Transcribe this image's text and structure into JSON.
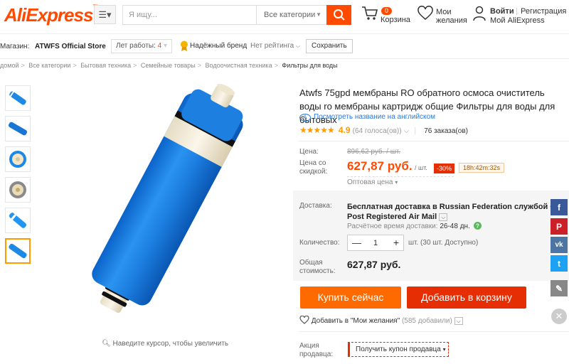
{
  "header": {
    "logo": "AliExpress",
    "logo_tm": "™",
    "menu_icon": "☰▾",
    "search_placeholder": "Я ищу...",
    "search_category": "Все категории",
    "cart_count": "0",
    "cart_label": "Корзина",
    "wishlist_line1": "Мои",
    "wishlist_line2": "желания",
    "login": "Войти",
    "separator": "|",
    "register": "Регистрация",
    "my_aliexpress": "Мой AliExpress",
    "brand_color": "#ff4a00"
  },
  "store": {
    "label": "Магазин:",
    "name": "ATWFS Official Store",
    "years_label": "Лет работы:",
    "years_value": "4",
    "brand_badge": "Надёжный бренд",
    "rating": "Нет рейтинга",
    "save_button": "Сохранить"
  },
  "breadcrumb": [
    "домой",
    "Все категории",
    "Бытовая техника",
    "Семейные товары",
    "Водоочистная техника",
    "Фильтры для воды"
  ],
  "gallery": {
    "zoom_hint": "Наведите курсор, чтобы увеличить",
    "thumbnail_count": 6,
    "active_thumbnail": 6
  },
  "product": {
    "title": "Atwfs 75gpd мембраны RO обратного осмоса очиститель воды ro мембраны картридж общие Фильтры для воды для бытовых",
    "translate_badge": "À",
    "translate_link": "Посмотреть название на английском",
    "stars": "★★★★★",
    "rating": "4.9",
    "votes": "(64 голоса(ов))",
    "orders": "76 заказа(ов)",
    "price_label": "Цена:",
    "old_price": "896,62 руб. / шт.",
    "discount_price_label": "Цена со скидкой:",
    "new_price": "627,87 руб.",
    "unit": "/ шт.",
    "discount": "-30%",
    "timer": "18h:42m:32s",
    "wholesale": "Оптовая цена",
    "shipping_label": "Доставка:",
    "shipping_line1": "Бесплатная доставка в Russian Federation службой China",
    "shipping_line2": "Post Registered Air Mail",
    "eta_label": "Расчётное время доставки:",
    "eta_value": "26-48",
    "eta_unit": "дн.",
    "quantity_label": "Количество:",
    "quantity_minus": "—",
    "quantity_value": "1",
    "quantity_plus": "+",
    "quantity_available": "шт. (30 шт. Доступно)",
    "total_label_1": "Общая",
    "total_label_2": "стоимость:",
    "total_value": "627,87 руб.",
    "buy_now": "Купить сейчас",
    "add_to_cart": "Добавить в корзину",
    "wish_text": "Добавить в \"Мои желания\"",
    "wish_count": "(585 добавили)",
    "promo_label_1": "Акция",
    "promo_label_2": "продавца:",
    "coupon": "Получить купон продавца"
  },
  "social": {
    "facebook": "f",
    "pinterest": "P",
    "vk": "vk",
    "twitter": "t",
    "edit": "✎",
    "close": "✕",
    "colors": {
      "facebook": "#3b5998",
      "pinterest": "#cb2027",
      "vk": "#4c75a3",
      "twitter": "#1da1f2",
      "edit": "#888888"
    }
  }
}
